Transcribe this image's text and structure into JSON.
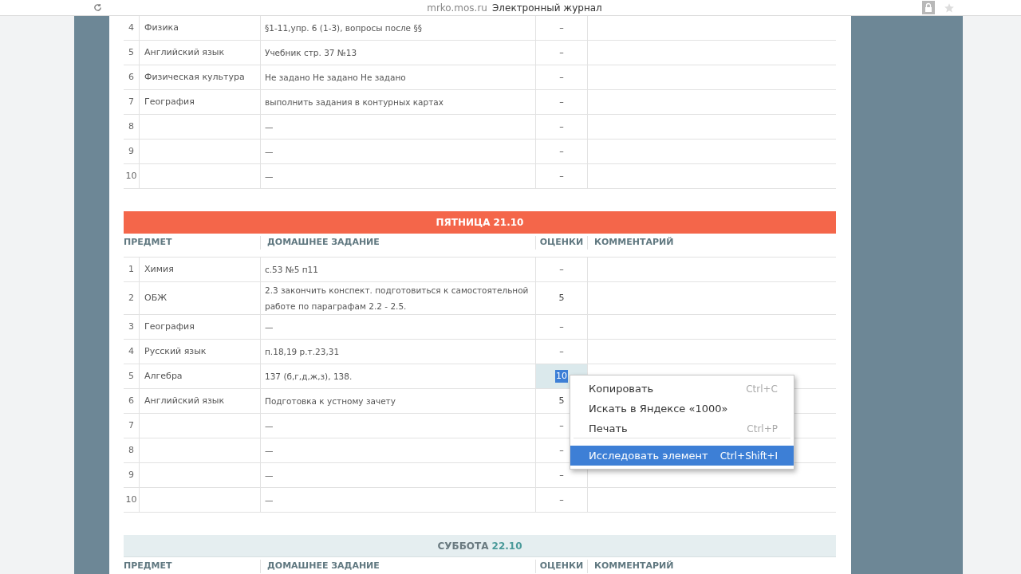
{
  "browser": {
    "domain": "mrko.mos.ru",
    "title": "Электронный журнал"
  },
  "days": [
    {
      "kind": "continued",
      "rows": [
        {
          "n": "4",
          "subject": "Физика",
          "homework": "§1-11,упр. 6 (1-3), вопросы после §§",
          "grade": "–",
          "grade_selected": false
        },
        {
          "n": "5",
          "subject": "Английский язык",
          "homework": "Учебник стр. 37 №13",
          "grade": "–",
          "grade_selected": false
        },
        {
          "n": "6",
          "subject": "Физическая культура",
          "homework": "Не задано Не задано Не задано",
          "grade": "–",
          "grade_selected": false
        },
        {
          "n": "7",
          "subject": "География",
          "homework": "выполнить задания в контурных картах",
          "grade": "–",
          "grade_selected": false
        },
        {
          "n": "8",
          "homework": "—",
          "grade": "–",
          "grade_selected": false
        },
        {
          "n": "9",
          "homework": "—",
          "grade": "–",
          "grade_selected": false
        },
        {
          "n": "10",
          "homework": "—",
          "grade": "–",
          "grade_selected": false
        }
      ]
    },
    {
      "kind": "day",
      "title": "ПЯТНИЦА",
      "date": "21.10",
      "highlighted": true,
      "columns": [
        "ПРЕДМЕТ",
        "ДОМАШНЕЕ ЗАДАНИЕ",
        "ОЦЕНКИ",
        "КОММЕНТАРИЙ"
      ],
      "rows": [
        {
          "n": "1",
          "subject": "Химия",
          "homework": "с.53 №5 п11",
          "grade": "–",
          "grade_selected": false
        },
        {
          "n": "2",
          "subject": "ОБЖ",
          "homework": "2.3 закончить конспект. подготовиться к самостоятельной работе по параграфам 2.2 - 2.5.",
          "grade": "5",
          "grade_selected": false
        },
        {
          "n": "3",
          "subject": "География",
          "homework": "—",
          "grade": "–",
          "grade_selected": false
        },
        {
          "n": "4",
          "subject": "Русский язык",
          "homework": "п.18,19 р.т.23,31",
          "grade": "–",
          "grade_selected": false
        },
        {
          "n": "5",
          "subject": "Алгебра",
          "homework": "137 (б,г,д,ж,з), 138.",
          "grade": "10",
          "grade_selected": true
        },
        {
          "n": "6",
          "subject": "Английский язык",
          "homework": "Подготовка к устному зачету",
          "grade": "5",
          "grade_selected": false
        },
        {
          "n": "7",
          "homework": "—",
          "grade": "–",
          "grade_selected": false
        },
        {
          "n": "8",
          "homework": "—",
          "grade": "–",
          "grade_selected": false
        },
        {
          "n": "9",
          "homework": "—",
          "grade": "–",
          "grade_selected": false
        },
        {
          "n": "10",
          "homework": "—",
          "grade": "–",
          "grade_selected": false
        }
      ]
    },
    {
      "kind": "day",
      "title": "СУББОТА",
      "date": "22.10",
      "highlighted": false,
      "columns": [
        "ПРЕДМЕТ",
        "ДОМАШНЕЕ ЗАДАНИЕ",
        "ОЦЕНКИ",
        "КОММЕНТАРИЙ"
      ]
    }
  ],
  "context_menu": {
    "items": [
      {
        "label": "Копировать",
        "shortcut": "Ctrl+C",
        "selected": false,
        "separator_before": false
      },
      {
        "label": "Искать в Яндексе «1000»",
        "selected": false,
        "separator_before": false
      },
      {
        "label": "Печать",
        "shortcut": "Ctrl+P",
        "selected": false,
        "separator_before": false
      },
      {
        "label": "Исследовать элемент",
        "shortcut": "Ctrl+Shift+I",
        "selected": true,
        "separator_before": true
      }
    ]
  }
}
